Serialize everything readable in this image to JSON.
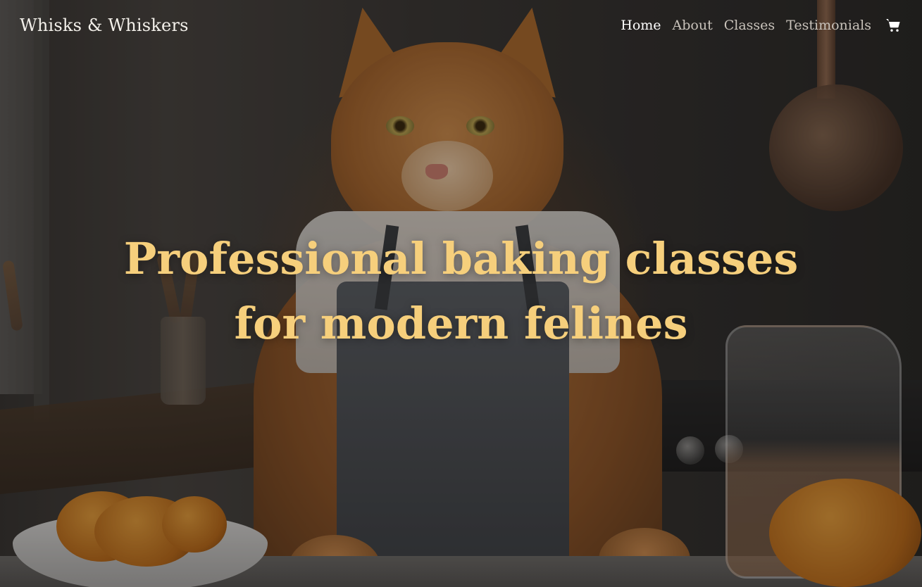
{
  "site": {
    "brand": "Whisks & Whiskers"
  },
  "nav": {
    "items": [
      {
        "label": "Home",
        "active": true
      },
      {
        "label": "About",
        "active": false
      },
      {
        "label": "Classes",
        "active": false
      },
      {
        "label": "Testimonials",
        "active": false
      }
    ],
    "cart_icon": "shopping-cart-icon"
  },
  "hero": {
    "headline_line1": "Professional baking classes",
    "headline_line2": "for modern felines",
    "headline_color": "#f6cf7c",
    "image_description_icon": "cat-baker-photo"
  },
  "colors": {
    "nav_active": "#ffffff",
    "nav_inactive": "#c9c3bb",
    "brand_text": "#f3f0ea"
  }
}
